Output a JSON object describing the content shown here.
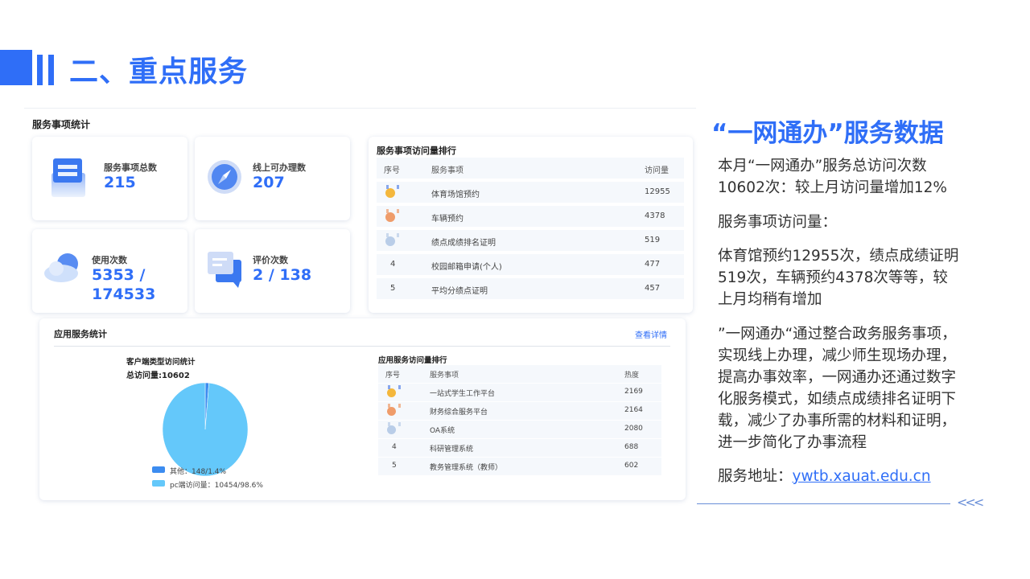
{
  "header": {
    "title": "二、重点服务"
  },
  "service_stats": {
    "title": "服务事项统计",
    "cards": [
      {
        "label": "服务事项总数",
        "value": "215",
        "icon": "document-card-icon"
      },
      {
        "label": "线上可办理数",
        "value": "207",
        "icon": "compass-icon"
      },
      {
        "label": "使用次数",
        "value": "5353 / 174533",
        "icon": "cloud-icon"
      },
      {
        "label": "评价次数",
        "value": "2 / 138",
        "icon": "comment-icon"
      }
    ]
  },
  "service_ranking": {
    "title": "服务事项访问量排行",
    "headers": [
      "序号",
      "服务事项",
      "访问量"
    ],
    "rows": [
      {
        "rank": "",
        "medal": "gold",
        "name": "体育场馆预约",
        "count": "12955"
      },
      {
        "rank": "",
        "medal": "bronze",
        "name": "车辆预约",
        "count": "4378"
      },
      {
        "rank": "",
        "medal": "silver",
        "name": "绩点成绩排名证明",
        "count": "519"
      },
      {
        "rank": "4",
        "medal": "",
        "name": "校园邮箱申请(个人)",
        "count": "477"
      },
      {
        "rank": "5",
        "medal": "",
        "name": "平均分绩点证明",
        "count": "457"
      }
    ]
  },
  "app_stats": {
    "title": "应用服务统计",
    "detail_link": "查看详情",
    "pie_title": "客户端类型访问统计",
    "pie_total": "总访问量:10602",
    "legend": [
      {
        "label": "其他：148/1.4%",
        "color": "#3c8cf0"
      },
      {
        "label": "pc端访问量：10454/98.6%",
        "color": "#64c8fa"
      }
    ],
    "app_ranking": {
      "title": "应用服务访问量排行",
      "headers": [
        "序号",
        "服务事项",
        "热度"
      ],
      "rows": [
        {
          "rank": "",
          "medal": "gold",
          "name": "一站式学生工作平台",
          "count": "2169"
        },
        {
          "rank": "",
          "medal": "bronze",
          "name": "财务综合服务平台",
          "count": "2164"
        },
        {
          "rank": "",
          "medal": "silver",
          "name": "OA系统",
          "count": "2080"
        },
        {
          "rank": "4",
          "medal": "",
          "name": "科研管理系统",
          "count": "688"
        },
        {
          "rank": "5",
          "medal": "",
          "name": "教务管理系统（教师）",
          "count": "602"
        }
      ]
    }
  },
  "chart_data": {
    "type": "pie",
    "title": "客户端类型访问统计",
    "subtitle": "总访问量:10602",
    "categories": [
      "其他",
      "pc端访问量"
    ],
    "values": [
      148,
      10454
    ],
    "percentages": [
      1.4,
      98.6
    ],
    "colors": [
      "#3c8cf0",
      "#64c8fa"
    ],
    "legend": "bottom-left"
  },
  "right": {
    "title": "“一网通办”服务数据",
    "p1": "本月“一网通办”服务总访问次数10602次：较上月访问量增加12%",
    "p2": "服务事项访问量：",
    "p3": "体育馆预约12955次，绩点成绩证明519次，车辆预约4378次等等，较上月均稍有增加",
    "p4": "”一网通办“通过整合政务服务事项，实现线上办理，减少师生现场办理，提高办事效率，一网通办还通过数字化服务模式，如绩点成绩排名证明下载，减少了办事所需的材料和证明，进一步简化了办事流程",
    "address_label": "服务地址：",
    "address_link": "ywtb.xauat.edu.cn",
    "arrows": "<<<"
  },
  "colors": {
    "accent": "#2f6ef7"
  }
}
